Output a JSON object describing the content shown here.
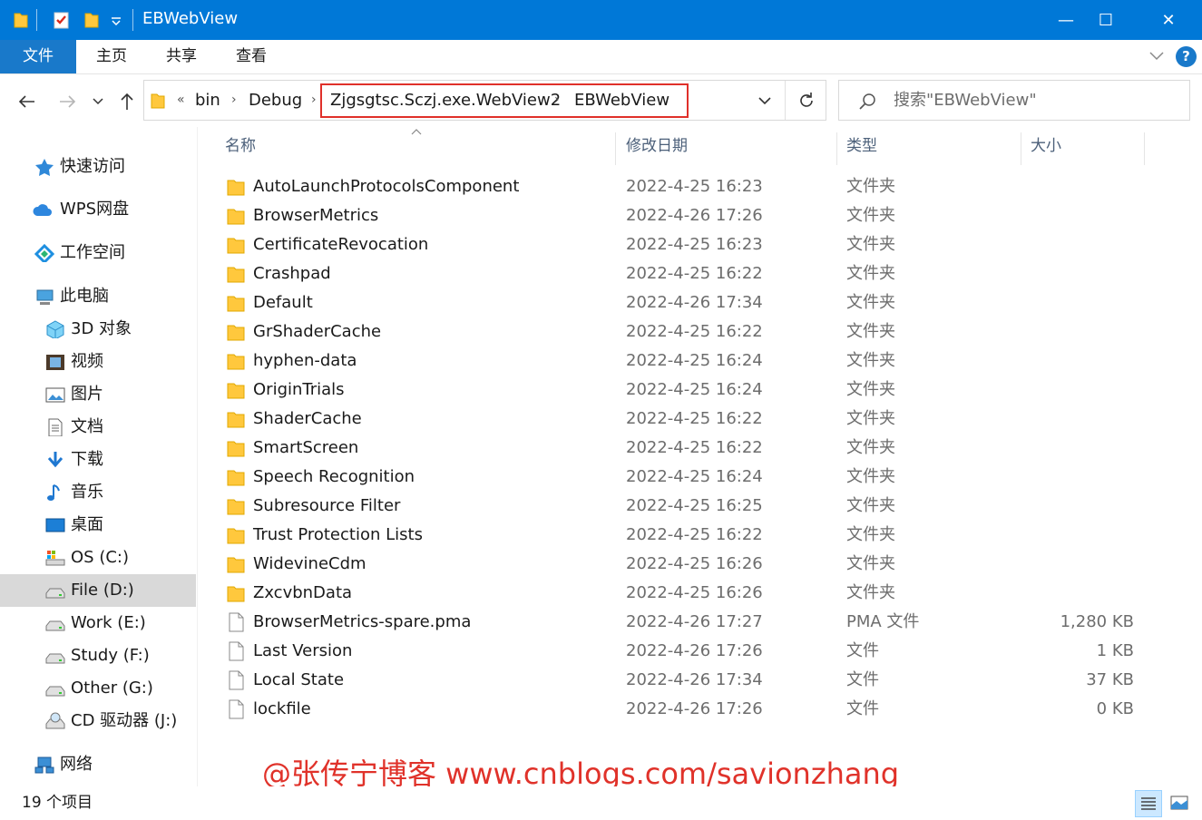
{
  "window": {
    "title": "EBWebView",
    "minimize_glyph": "—",
    "maximize_glyph": "☐",
    "close_glyph": "✕"
  },
  "colors": {
    "titlebar": "#0078d7",
    "file_tab": "#1979ca",
    "highlight_box": "#e0302a",
    "watermark": "#e0322a",
    "folder": "#ffc83d",
    "selected_nav": "#d9d9d9"
  },
  "ribbon": {
    "tabs": [
      "文件",
      "主页",
      "共享",
      "查看"
    ],
    "help_label": "?"
  },
  "address": {
    "overflow": "«",
    "segments": [
      "bin",
      "Debug",
      "Zjgsgtsc.Sczj.exe.WebView2",
      "EBWebView"
    ]
  },
  "search": {
    "placeholder": "搜索\"EBWebView\""
  },
  "sidebar": {
    "items": [
      {
        "label": "快速访问",
        "icon": "star-icon"
      },
      {
        "label": "WPS网盘",
        "icon": "cloud-icon"
      },
      {
        "label": "工作空间",
        "icon": "workspace-icon"
      },
      {
        "label": "此电脑",
        "icon": "computer-icon"
      },
      {
        "label": "3D 对象",
        "icon": "cube-icon"
      },
      {
        "label": "视频",
        "icon": "video-icon"
      },
      {
        "label": "图片",
        "icon": "picture-icon"
      },
      {
        "label": "文档",
        "icon": "document-icon"
      },
      {
        "label": "下载",
        "icon": "download-icon"
      },
      {
        "label": "音乐",
        "icon": "music-icon"
      },
      {
        "label": "桌面",
        "icon": "desktop-icon"
      },
      {
        "label": "OS (C:)",
        "icon": "drive-os-icon"
      },
      {
        "label": "File (D:)",
        "icon": "drive-icon",
        "selected": true
      },
      {
        "label": "Work (E:)",
        "icon": "drive-icon"
      },
      {
        "label": "Study (F:)",
        "icon": "drive-icon"
      },
      {
        "label": "Other (G:)",
        "icon": "drive-icon"
      },
      {
        "label": "CD 驱动器 (J:)",
        "icon": "cd-drive-icon"
      },
      {
        "label": "网络",
        "icon": "network-icon"
      }
    ]
  },
  "columns": {
    "name": "名称",
    "date": "修改日期",
    "type": "类型",
    "size": "大小"
  },
  "files": [
    {
      "name": "AutoLaunchProtocolsComponent",
      "date": "2022-4-25 16:23",
      "type": "文件夹",
      "size": "",
      "kind": "folder"
    },
    {
      "name": "BrowserMetrics",
      "date": "2022-4-26 17:26",
      "type": "文件夹",
      "size": "",
      "kind": "folder"
    },
    {
      "name": "CertificateRevocation",
      "date": "2022-4-25 16:23",
      "type": "文件夹",
      "size": "",
      "kind": "folder"
    },
    {
      "name": "Crashpad",
      "date": "2022-4-25 16:22",
      "type": "文件夹",
      "size": "",
      "kind": "folder"
    },
    {
      "name": "Default",
      "date": "2022-4-26 17:34",
      "type": "文件夹",
      "size": "",
      "kind": "folder"
    },
    {
      "name": "GrShaderCache",
      "date": "2022-4-25 16:22",
      "type": "文件夹",
      "size": "",
      "kind": "folder"
    },
    {
      "name": "hyphen-data",
      "date": "2022-4-25 16:24",
      "type": "文件夹",
      "size": "",
      "kind": "folder"
    },
    {
      "name": "OriginTrials",
      "date": "2022-4-25 16:24",
      "type": "文件夹",
      "size": "",
      "kind": "folder"
    },
    {
      "name": "ShaderCache",
      "date": "2022-4-25 16:22",
      "type": "文件夹",
      "size": "",
      "kind": "folder"
    },
    {
      "name": "SmartScreen",
      "date": "2022-4-25 16:22",
      "type": "文件夹",
      "size": "",
      "kind": "folder"
    },
    {
      "name": "Speech Recognition",
      "date": "2022-4-25 16:24",
      "type": "文件夹",
      "size": "",
      "kind": "folder"
    },
    {
      "name": "Subresource Filter",
      "date": "2022-4-25 16:25",
      "type": "文件夹",
      "size": "",
      "kind": "folder"
    },
    {
      "name": "Trust Protection Lists",
      "date": "2022-4-25 16:22",
      "type": "文件夹",
      "size": "",
      "kind": "folder"
    },
    {
      "name": "WidevineCdm",
      "date": "2022-4-25 16:26",
      "type": "文件夹",
      "size": "",
      "kind": "folder"
    },
    {
      "name": "ZxcvbnData",
      "date": "2022-4-25 16:26",
      "type": "文件夹",
      "size": "",
      "kind": "folder"
    },
    {
      "name": "BrowserMetrics-spare.pma",
      "date": "2022-4-26 17:27",
      "type": "PMA 文件",
      "size": "1,280 KB",
      "kind": "file"
    },
    {
      "name": "Last Version",
      "date": "2022-4-26 17:26",
      "type": "文件",
      "size": "1 KB",
      "kind": "file"
    },
    {
      "name": "Local State",
      "date": "2022-4-26 17:34",
      "type": "文件",
      "size": "37 KB",
      "kind": "file"
    },
    {
      "name": "lockfile",
      "date": "2022-4-26 17:26",
      "type": "文件",
      "size": "0 KB",
      "kind": "file"
    }
  ],
  "watermark": "@张传宁博客 www.cnblogs.com/savionzhang",
  "status": {
    "item_count": "19 个项目"
  }
}
